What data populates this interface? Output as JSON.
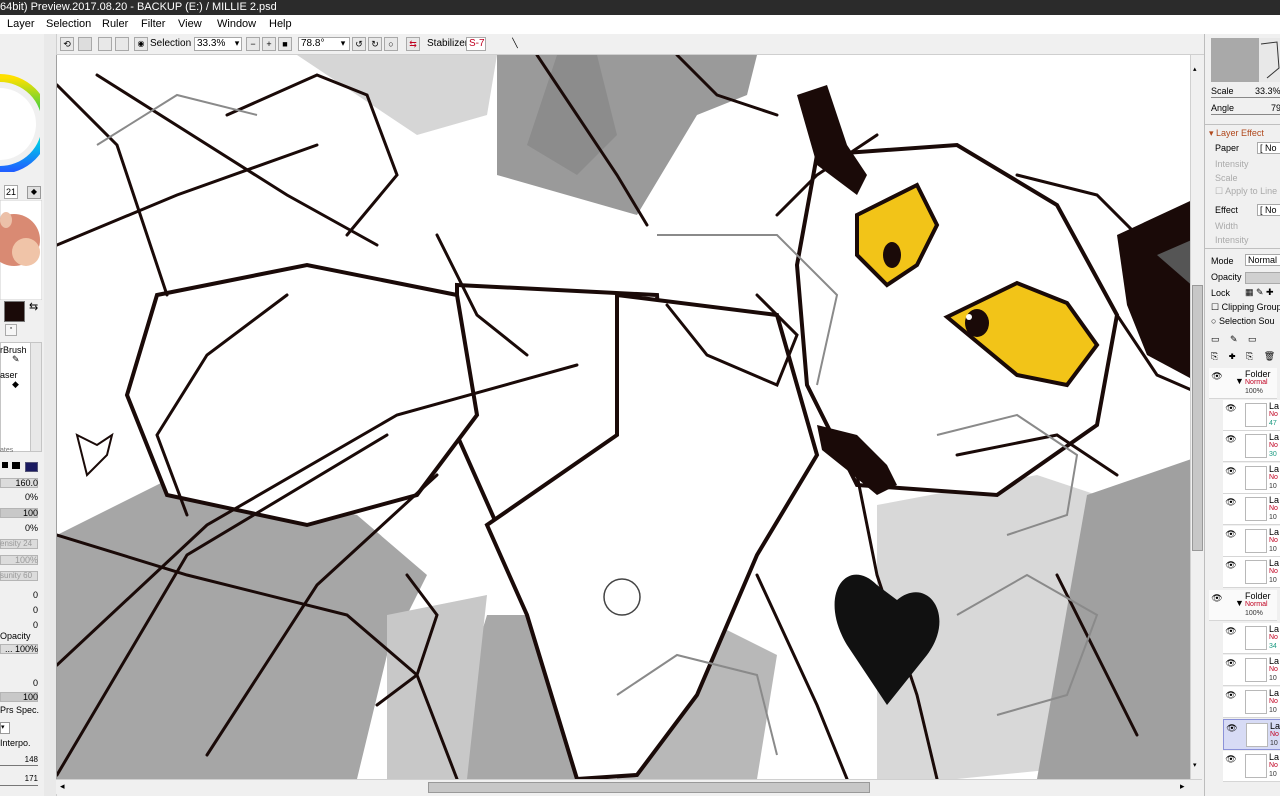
{
  "title": "64bit) Preview.2017.08.20 - BACKUP (E:) / MILLIE 2.psd",
  "menu": [
    "Layer",
    "Selection",
    "Ruler",
    "Filter",
    "View",
    "Window",
    "Help"
  ],
  "toolbar": {
    "selection_label": "Selection",
    "zoom": "33.3%",
    "angle": "78.8°",
    "stabilizer_label": "Stabilizer",
    "stabilizer_value": "S-7"
  },
  "left": {
    "brush_size": "21",
    "tools": [
      "rBrush",
      "aser",
      "ates"
    ],
    "size_value": "160.0",
    "min_size": "0%",
    "density": "100",
    "min_density": "0%",
    "blending": "ensity 24",
    "dilution": "100%",
    "persistence": "sunity 60",
    "v1": "0",
    "v2": "0",
    "v3": "0",
    "opacity_label": "Opacity",
    "opacity_value": "... 100%",
    "v4": "0",
    "v5": "100",
    "prs_spec": "Prs Spec.",
    "interpo": "Interpo.",
    "v6": "148",
    "v7": "171"
  },
  "right": {
    "scale_label": "Scale",
    "scale_value": "33.3%",
    "angle_label": "Angle",
    "angle_value": "79",
    "layer_effect": "Layer Effect",
    "paper_label": "Paper",
    "paper_value": "[ No",
    "intensity_label": "Intensity",
    "scale2_label": "Scale",
    "apply_label": "Apply to Line",
    "effect_label": "Effect",
    "effect_value": "[ No",
    "width_label": "Width",
    "intensity2_label": "Intensity",
    "mode_label": "Mode",
    "mode_value": "Normal",
    "opacity_label": "Opacity",
    "lock_label": "Lock",
    "clipping_label": "Clipping Group",
    "selsrc_label": "Selection Sou",
    "layers": [
      {
        "name": "Folder",
        "mode": "Normal",
        "opacity": "100%",
        "folder": true
      },
      {
        "name": "La",
        "mode": "No",
        "opacity": "47"
      },
      {
        "name": "La",
        "mode": "No",
        "opacity": "30"
      },
      {
        "name": "La",
        "mode": "No",
        "opacity": "10"
      },
      {
        "name": "La",
        "mode": "No",
        "opacity": "10"
      },
      {
        "name": "La",
        "mode": "No",
        "opacity": "10"
      },
      {
        "name": "La",
        "mode": "No",
        "opacity": "10"
      },
      {
        "name": "Folder",
        "mode": "Normal",
        "opacity": "100%",
        "folder": true
      },
      {
        "name": "La",
        "mode": "No",
        "opacity": "34"
      },
      {
        "name": "La",
        "mode": "No",
        "opacity": "10"
      },
      {
        "name": "La",
        "mode": "No",
        "opacity": "10"
      },
      {
        "name": "La",
        "mode": "No",
        "opacity": "10"
      },
      {
        "name": "La",
        "mode": "No",
        "opacity": "10"
      }
    ]
  },
  "colors": {
    "eye_yellow": "#f2c418",
    "ink": "#1a0a08",
    "accent": "#c00020"
  }
}
